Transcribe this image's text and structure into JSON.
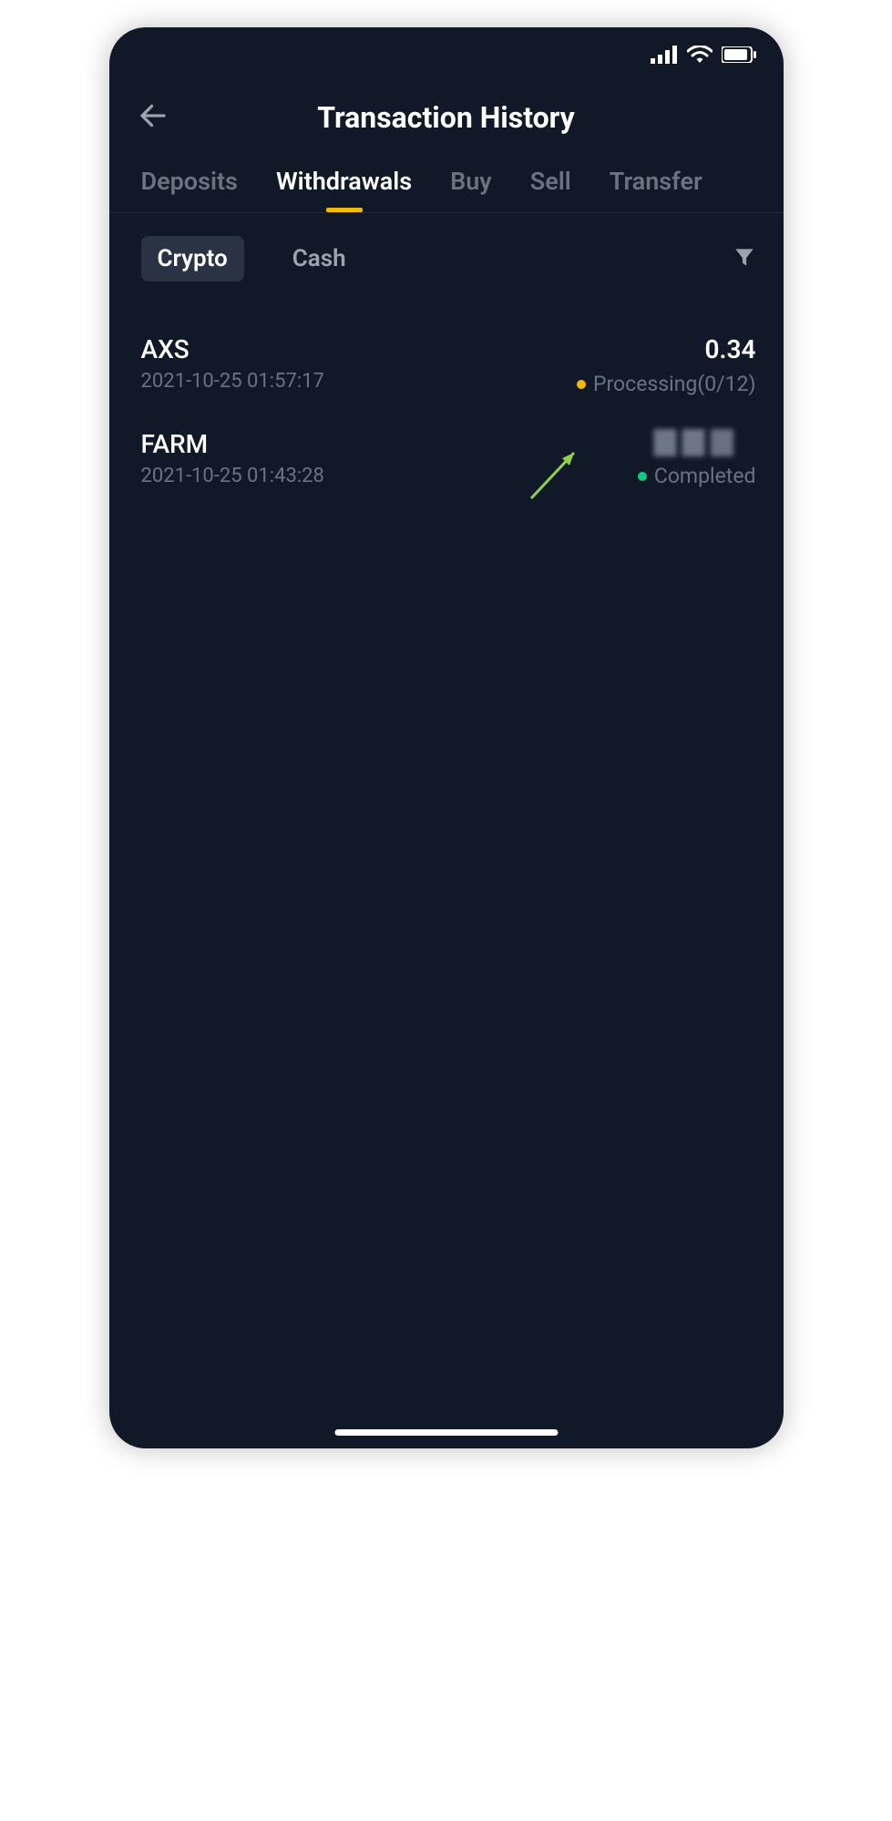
{
  "header": {
    "title": "Transaction History"
  },
  "tabs": [
    {
      "label": "Deposits",
      "active": false
    },
    {
      "label": "Withdrawals",
      "active": true
    },
    {
      "label": "Buy",
      "active": false
    },
    {
      "label": "Sell",
      "active": false
    },
    {
      "label": "Transfer",
      "active": false
    }
  ],
  "filter": {
    "pills": [
      {
        "label": "Crypto",
        "active": true
      },
      {
        "label": "Cash",
        "active": false
      }
    ]
  },
  "transactions": [
    {
      "symbol": "AXS",
      "timestamp": "2021-10-25 01:57:17",
      "amount": "0.34",
      "status": "Processing(0/12)",
      "status_color": "yellow",
      "blurred": false
    },
    {
      "symbol": "FARM",
      "timestamp": "2021-10-25 01:43:28",
      "amount": "",
      "status": "Completed",
      "status_color": "green",
      "blurred": true
    }
  ]
}
